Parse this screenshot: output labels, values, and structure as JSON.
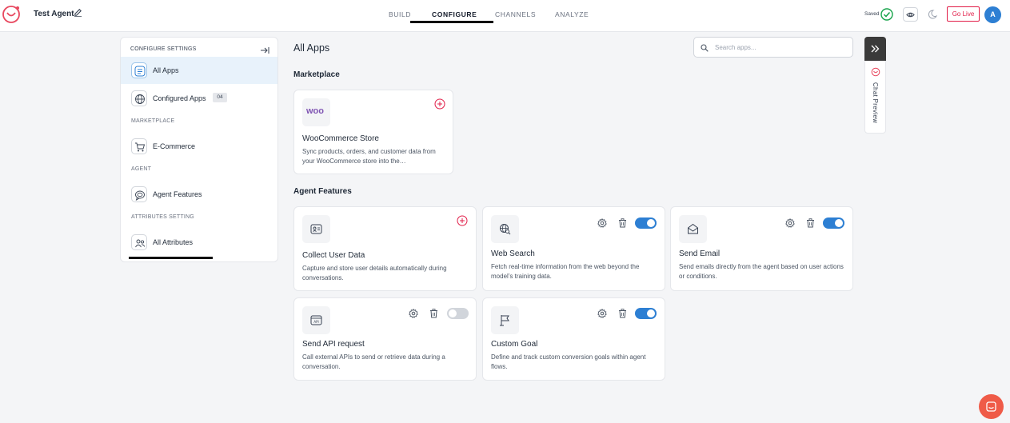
{
  "header": {
    "agent_name": "Test Agent",
    "tabs": [
      {
        "label": "BUILD",
        "active": false
      },
      {
        "label": "CONFIGURE",
        "active": true
      },
      {
        "label": "CHANNELS",
        "active": false
      },
      {
        "label": "ANALYZE",
        "active": false
      }
    ],
    "saved_text": "Saved",
    "go_live_label": "Go Live",
    "avatar_initial": "A"
  },
  "sidebar": {
    "title": "CONFIGURE SETTINGS",
    "items": [
      {
        "label": "All Apps",
        "icon": "list-icon",
        "active": true
      },
      {
        "label": "Configured Apps",
        "icon": "globe-icon",
        "badge": "04"
      },
      {
        "label": "E-Commerce",
        "icon": "cart-icon"
      },
      {
        "label": "Agent Features",
        "icon": "chat-bubble-icon"
      },
      {
        "label": "All Attributes",
        "icon": "users-icon"
      }
    ],
    "sections": [
      "MARKETPLACE",
      "AGENT",
      "ATTRIBUTES SETTING"
    ]
  },
  "main": {
    "title": "All Apps",
    "search_placeholder": "Search apps...",
    "marketplace_heading": "Marketplace",
    "agent_features_heading": "Agent Features",
    "marketplace_apps": [
      {
        "title": "WooCommerce Store",
        "logo_text": "woo",
        "description": "Sync products, orders, and customer data from your WooCommerce store into the…"
      }
    ],
    "agent_features": [
      {
        "title": "Collect User Data",
        "description": "Capture and store user details automatically during conversations.",
        "enabled": null
      },
      {
        "title": "Web Search",
        "description": "Fetch real-time information from the web beyond the model’s training data.",
        "enabled": true
      },
      {
        "title": "Send Email",
        "description": "Send emails directly from the agent based on user actions or conditions.",
        "enabled": true
      },
      {
        "title": "Send API request",
        "description": "Call external APIs to send or retrieve data during a conversation.",
        "enabled": false
      },
      {
        "title": "Custom Goal",
        "description": "Define and track custom conversion goals within agent flows.",
        "enabled": true
      }
    ]
  },
  "chat_preview": {
    "label": "Chat Preview"
  },
  "colors": {
    "accent": "#2d7fd3",
    "brand": "#e11d48",
    "help": "#ef5b48"
  }
}
